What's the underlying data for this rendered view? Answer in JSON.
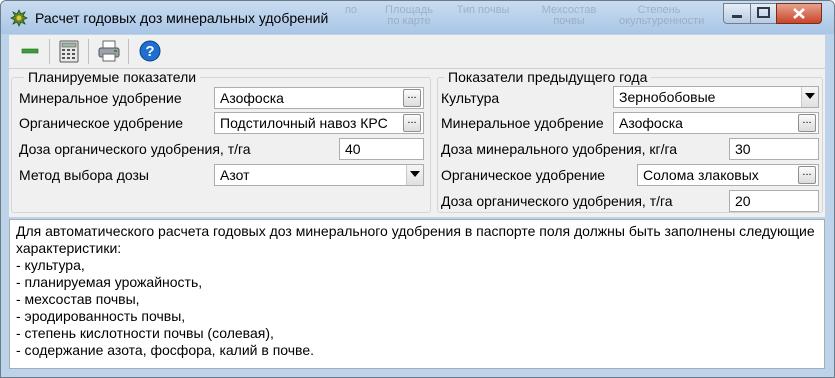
{
  "window": {
    "title": "Расчет годовых доз минеральных удобрений",
    "background_menu_fragments": [
      "по",
      "Площадь\nпо карте",
      "Тип почвы",
      "Мехсостав\nпочвы",
      "Степень\nокультуренности"
    ]
  },
  "toolbar": {
    "buttons": [
      "minus-icon",
      "calculator-icon",
      "printer-icon",
      "help-icon"
    ],
    "help_glyph": "?"
  },
  "planned": {
    "legend": "Планируемые показатели",
    "mineral_label": "Минеральное удобрение",
    "mineral_value": "Азофоска",
    "organic_label": "Органическое удобрение",
    "organic_value": "Подстилочный навоз КРС",
    "dose_label": "Доза органического удобрения, т/га",
    "dose_value": "40",
    "method_label": "Метод выбора дозы",
    "method_value": "Азот"
  },
  "previous": {
    "legend": "Показатели предыдущего года",
    "crop_label": "Культура",
    "crop_value": "Зернобобовые",
    "mineral_label": "Минеральное удобрение",
    "mineral_value": "Азофоска",
    "mineral_dose_label": "Доза минерального удобрения, кг/га",
    "mineral_dose_value": "30",
    "organic_label": "Органическое удобрение",
    "organic_value": "Солома злаковых",
    "organic_dose_label": "Доза органического удобрения, т/га",
    "organic_dose_value": "20"
  },
  "ellipsis": "...",
  "info": {
    "lines": [
      "Для автоматического расчета годовых доз минерального удобрения в паспорте поля должны быть заполнены следующие",
      "характеристики:",
      "- культура,",
      "- планируемая урожайность,",
      "- мехсостав почвы,",
      "- эродированность почвы,",
      "- степень кислотности почвы (солевая),",
      "- содержание азота, фосфора, калий в почве."
    ]
  },
  "colors": {
    "title_bar": "#bcd3ea",
    "panel": "#f0f0f0",
    "close_button": "#c8452a",
    "help_blue": "#1f6fd0",
    "minus_green": "#3aa13a"
  }
}
